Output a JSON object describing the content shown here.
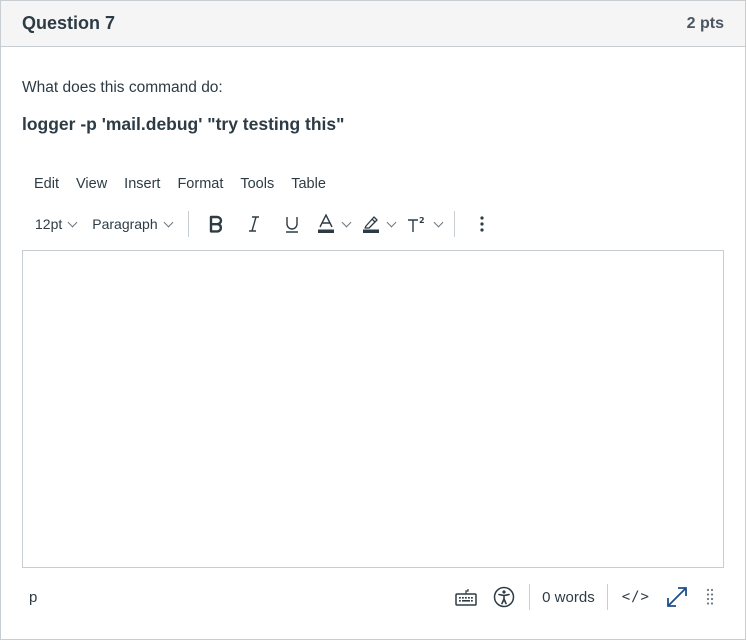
{
  "question": {
    "title": "Question 7",
    "points": "2 pts",
    "prompt": "What does this command do:",
    "command": "logger -p 'mail.debug' \"try testing this\""
  },
  "editor": {
    "menu": [
      "Edit",
      "View",
      "Insert",
      "Format",
      "Tools",
      "Table"
    ],
    "toolbar": {
      "font_size": "12pt",
      "block_format": "Paragraph",
      "bold_icon": "bold-icon",
      "italic_icon": "italic-icon",
      "underline_icon": "underline-icon",
      "text_color_icon": "text-color-icon",
      "highlight_icon": "highlight-icon",
      "superscript_icon": "superscript-icon",
      "more_icon": "more-vertical-icon",
      "text_color": "#2d3b45",
      "highlight_color": "#2d3b45"
    },
    "content": "",
    "status": {
      "path": "p",
      "word_count": "0 words",
      "html_toggle": "</>",
      "keyboard_icon": "keyboard-icon",
      "accessibility_icon": "accessibility-icon",
      "fullscreen_icon": "fullscreen-icon",
      "resize_icon": "resize-handle-icon"
    }
  },
  "colors": {
    "text": "#2d3b45",
    "border": "#c7cdd1",
    "header_bg": "#f5f5f5",
    "icon_accent": "#2d3b45"
  }
}
